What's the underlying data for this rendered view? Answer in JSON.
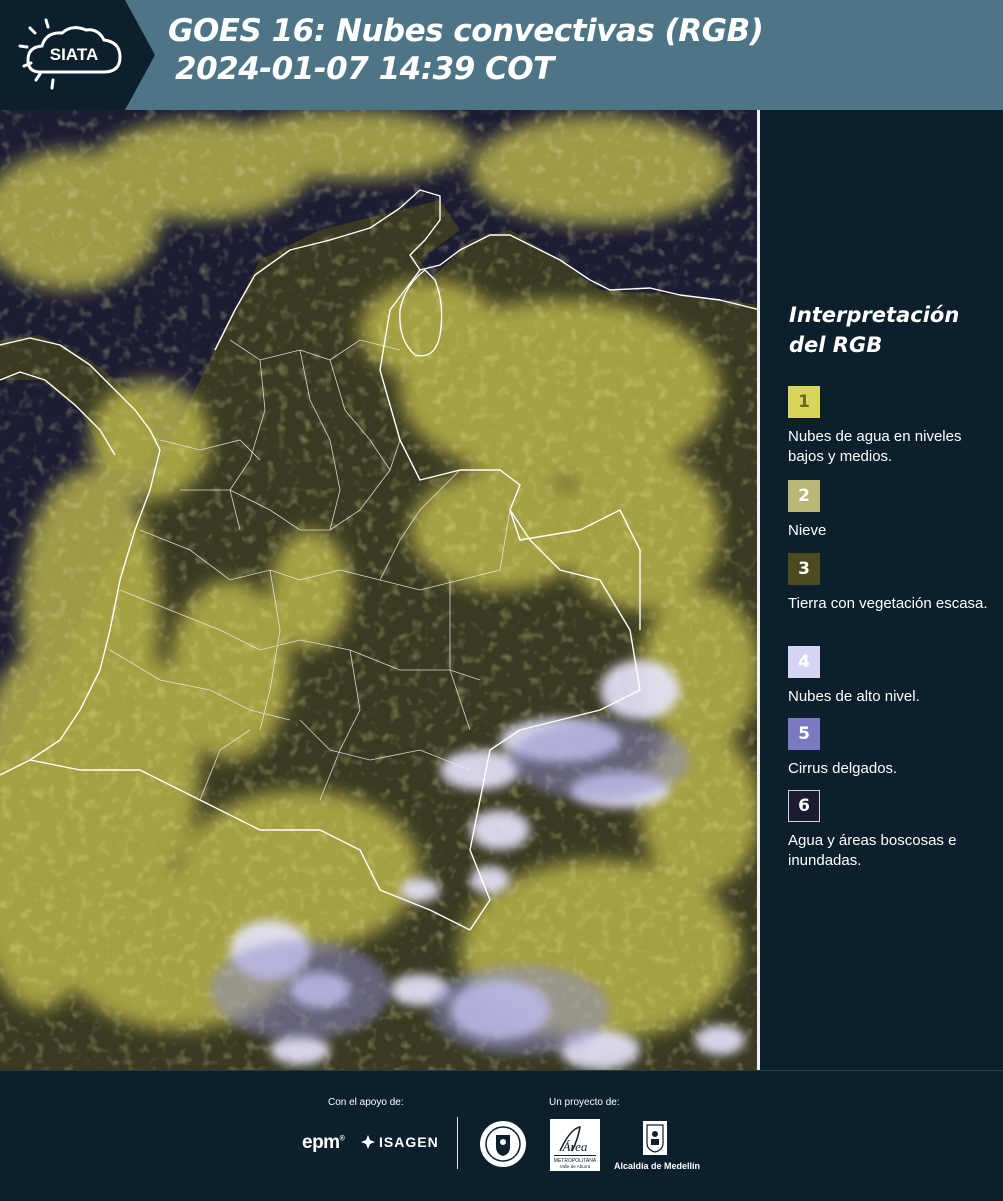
{
  "header": {
    "title_line1": "GOES 16: Nubes convectivas (RGB)",
    "title_line2": "2024-01-07 14:39 COT",
    "logo_text": "SIATA",
    "background_color": "#4d7585"
  },
  "legend": {
    "title": "Interpretación del RGB",
    "items": [
      {
        "number": "1",
        "label": "Nubes de agua en niveles bajos y medios.",
        "color": "#d9d55a"
      },
      {
        "number": "2",
        "label": "Nieve",
        "color": "#b9b876"
      },
      {
        "number": "3",
        "label": "Tierra con vegetación escasa.",
        "color": "#4b4b1d"
      },
      {
        "number": "4",
        "label": "Nubes de alto nivel.",
        "color": "#d6d4f5"
      },
      {
        "number": "5",
        "label": "Cirrus delgados.",
        "color": "#7b79bf"
      },
      {
        "number": "6",
        "label": "Agua y áreas boscosas e inundadas.",
        "color": "#1b1b34"
      }
    ]
  },
  "footer": {
    "support_label": "Con el apoyo de:",
    "project_label": "Un proyecto de:",
    "support_logos": [
      "epm",
      "ISAGEN"
    ],
    "alcaldia_text": "Alcaldía de Medellín"
  }
}
